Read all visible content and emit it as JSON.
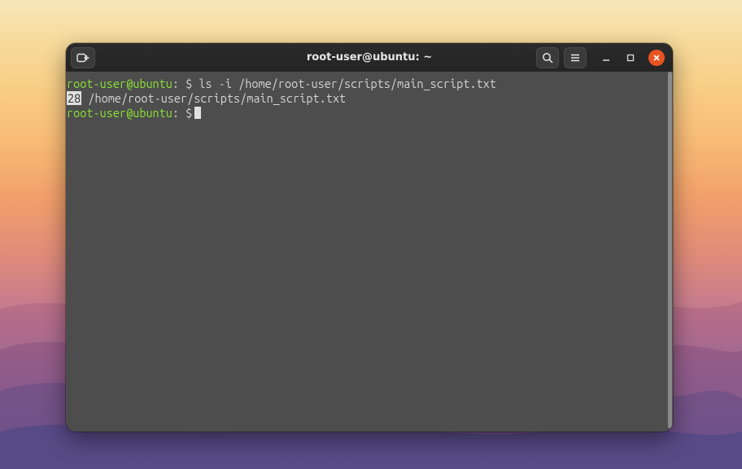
{
  "title": "root-user@ubuntu: ~",
  "prompt": {
    "userhost": "root-user@ubuntu",
    "sep": ":",
    "dir": "~",
    "sym": "$"
  },
  "command": "ls -i /home/root-user/scripts/main_script.txt",
  "output": {
    "inode": "28",
    "path": "/home/root-user/scripts/main_script.txt"
  },
  "icons": {
    "newtab": "new-tab-icon",
    "search": "search-icon",
    "menu": "hamburger-menu-icon",
    "min": "minimize-icon",
    "max": "maximize-icon",
    "close": "close-icon"
  }
}
